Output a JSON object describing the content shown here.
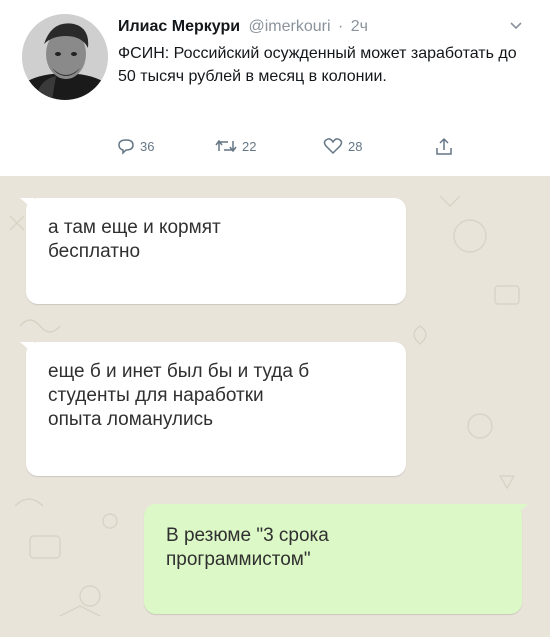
{
  "tweet": {
    "author_name": "Илиас Меркури",
    "handle": "@imerkouri",
    "separator": "·",
    "time": "2ч",
    "text": "ФСИН: Российский осужденный может заработать до 50 тысяч рублей в месяц в колонии.",
    "actions": {
      "reply_count": "36",
      "retweet_count": "22",
      "like_count": "28"
    },
    "icons": [
      "avatar-photo",
      "chevron-down-icon",
      "reply-icon",
      "retweet-icon",
      "heart-icon",
      "share-icon"
    ]
  },
  "chat": {
    "messages": [
      {
        "direction": "incoming",
        "text": "а там еще и кормят\nбесплатно"
      },
      {
        "direction": "incoming",
        "text": "еще б и инет был бы и туда б\nстуденты для наработки\nопыта ломанулись"
      },
      {
        "direction": "outgoing",
        "text": "В резюме \"3 срока\nпрограммистом\""
      }
    ]
  },
  "colors": {
    "chat_background": "#e9e4da",
    "incoming_bubble": "#ffffff",
    "outgoing_bubble": "#dcf8c6",
    "tweet_secondary_text": "#657786"
  }
}
